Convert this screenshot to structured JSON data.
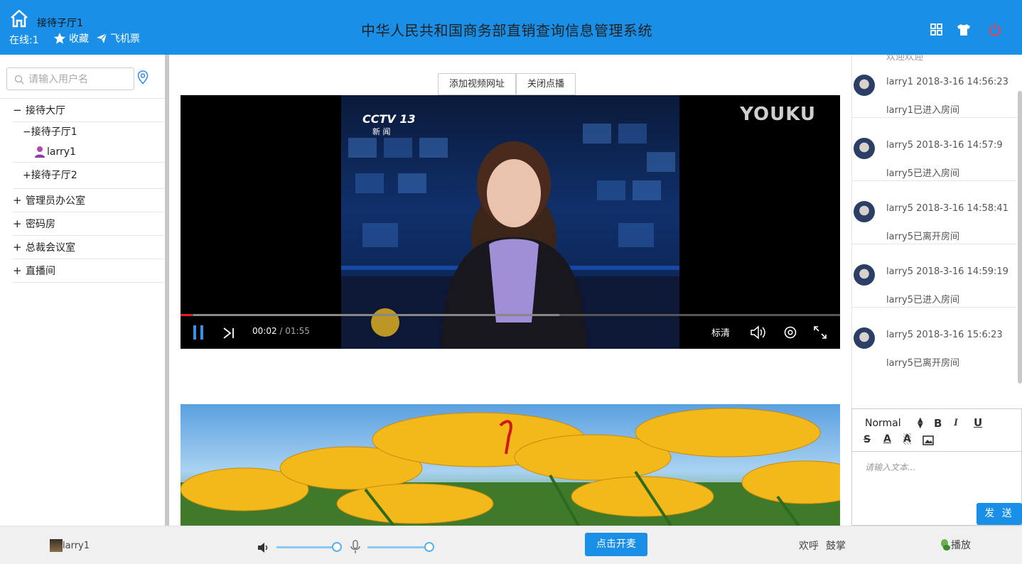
{
  "header": {
    "room_name": "接待子厅1",
    "online": "在线:1",
    "favorites": "收藏",
    "ticket": "飞机票",
    "title": "中华人民共和国商务部直销查询信息管理系统",
    "icons": [
      "grid-icon",
      "shirt-icon",
      "power-icon"
    ]
  },
  "sidebar": {
    "search_placeholder": "请输入用户名",
    "tree": {
      "hall": {
        "sign": "−",
        "label": "接待大厅"
      },
      "subhall1": {
        "sign": "−",
        "label": "接待子厅1"
      },
      "user": "larry1",
      "subhall2": {
        "sign": "+",
        "label": "接待子厅2"
      },
      "rooms": [
        {
          "sign": "+",
          "label": "管理员办公室"
        },
        {
          "sign": "+",
          "label": "密码房"
        },
        {
          "sign": "+",
          "label": "总裁会议室"
        },
        {
          "sign": "+",
          "label": "直播间"
        }
      ]
    }
  },
  "main": {
    "add_video_label": "添加视频网址",
    "close_vod_label": "关闭点播",
    "player": {
      "channel": "CCTV 13",
      "channel_sub": "新 闻",
      "watermark": "YOUKU",
      "current_time": "00:02",
      "duration": "/ 01:55",
      "quality": "标清",
      "progress": 0.017
    }
  },
  "chat": {
    "messages": [
      {
        "meta": "larry1 2018-3-16 14:56:23",
        "text": "larry1已进入房间"
      },
      {
        "meta": "larry5 2018-3-16 14:57:9",
        "text": "larry5已进入房间"
      },
      {
        "meta": "larry5 2018-3-16 14:58:41",
        "text": "larry5已离开房间"
      },
      {
        "meta": "larry5 2018-3-16 14:59:19",
        "text": "larry5已进入房间"
      },
      {
        "meta": "larry5 2018-3-16 15:6:23",
        "text": "larry5已离开房间"
      }
    ],
    "top_cut_text": "欢迎欢迎"
  },
  "editor": {
    "font_select": "Normal",
    "placeholder": "请输入文本...",
    "send_label": "发 送"
  },
  "footer": {
    "user": "larry1",
    "start_label": "点击开麦",
    "cheer": "欢呼",
    "clap": "鼓掌",
    "play": "播放",
    "volume": 1.0,
    "mic": 1.0
  }
}
